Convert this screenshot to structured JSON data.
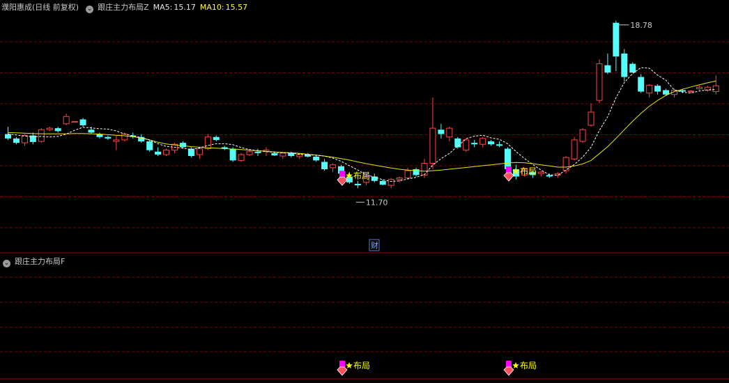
{
  "header": {
    "stock_name": "濮阳惠成",
    "period": "(日线 前复权)",
    "indicator_main": "跟庄主力布局Z",
    "ma5_label": "MA5:",
    "ma5_value": "15.17",
    "ma10_label": "MA10:",
    "ma10_value": "15.57"
  },
  "sub_panel": {
    "indicator": "跟庄主力布局F"
  },
  "colors": {
    "background": "#000000",
    "grid": "#7a0000",
    "separator": "#a00000",
    "up": "#ff4444",
    "down": "#54fcfc",
    "ma5": "#ffffff",
    "ma10": "#e8e800",
    "header_text": "#c8c8c8",
    "ma5_text": "#e6e6e6",
    "ma10_text": "#ffff33",
    "signal_star": "#ffff00",
    "signal_block": "#ff00ff",
    "signal_gem": "#ff5060"
  },
  "chart_data": {
    "type": "candlestick",
    "ylim": [
      11.4,
      19.2
    ],
    "candles": [
      [
        15.05,
        15.3,
        14.85,
        14.9
      ],
      [
        14.9,
        14.95,
        14.7,
        14.75
      ],
      [
        14.75,
        15.05,
        14.65,
        15.0
      ],
      [
        15.0,
        15.1,
        14.7,
        14.78
      ],
      [
        14.8,
        15.25,
        14.75,
        15.2
      ],
      [
        15.2,
        15.3,
        15.15,
        15.25
      ],
      [
        15.25,
        15.3,
        15.1,
        15.15
      ],
      [
        15.4,
        15.75,
        15.35,
        15.65
      ],
      [
        15.45,
        15.5,
        15.45,
        15.48
      ],
      [
        15.55,
        15.6,
        15.3,
        15.35
      ],
      [
        15.2,
        15.3,
        15.05,
        15.1
      ],
      [
        15.05,
        15.1,
        14.9,
        14.95
      ],
      [
        14.95,
        15.0,
        14.85,
        14.9
      ],
      [
        14.8,
        15.0,
        14.5,
        14.85
      ],
      [
        14.85,
        15.1,
        14.8,
        15.05
      ],
      [
        15.0,
        15.1,
        14.9,
        14.95
      ],
      [
        14.95,
        15.05,
        14.75,
        14.8
      ],
      [
        14.8,
        14.85,
        14.45,
        14.5
      ],
      [
        14.45,
        14.6,
        14.3,
        14.35
      ],
      [
        14.35,
        14.55,
        14.3,
        14.5
      ],
      [
        14.5,
        14.75,
        14.4,
        14.7
      ],
      [
        14.75,
        14.8,
        14.55,
        14.6
      ],
      [
        14.55,
        14.6,
        14.25,
        14.3
      ],
      [
        14.35,
        14.6,
        14.2,
        14.55
      ],
      [
        14.55,
        15.05,
        14.5,
        14.95
      ],
      [
        14.95,
        15.0,
        14.8,
        14.85
      ],
      [
        14.6,
        14.65,
        14.5,
        14.55
      ],
      [
        14.55,
        14.6,
        14.1,
        14.15
      ],
      [
        14.15,
        14.4,
        14.1,
        14.35
      ],
      [
        14.35,
        14.5,
        14.3,
        14.45
      ],
      [
        14.45,
        14.55,
        14.3,
        14.4
      ],
      [
        14.45,
        14.6,
        14.3,
        14.5
      ],
      [
        14.4,
        14.45,
        14.3,
        14.32
      ],
      [
        14.3,
        14.45,
        14.2,
        14.4
      ],
      [
        14.4,
        14.45,
        14.25,
        14.3
      ],
      [
        14.28,
        14.4,
        14.2,
        14.35
      ],
      [
        14.35,
        14.4,
        14.25,
        14.28
      ],
      [
        14.28,
        14.32,
        14.1,
        14.15
      ],
      [
        14.1,
        14.2,
        13.8,
        13.85
      ],
      [
        13.9,
        14.05,
        13.75,
        14.0
      ],
      [
        13.95,
        14.0,
        13.65,
        13.7
      ],
      [
        13.6,
        13.75,
        13.35,
        13.4
      ],
      [
        13.35,
        13.45,
        13.2,
        13.3
      ],
      [
        13.4,
        13.7,
        13.3,
        13.6
      ],
      [
        13.6,
        13.7,
        13.4,
        13.45
      ],
      [
        13.45,
        13.5,
        13.3,
        13.32
      ],
      [
        13.3,
        13.55,
        13.2,
        13.5
      ],
      [
        13.5,
        13.6,
        13.4,
        13.55
      ],
      [
        13.55,
        13.9,
        13.5,
        13.8
      ],
      [
        13.85,
        13.9,
        13.6,
        13.65
      ],
      [
        13.65,
        14.2,
        13.55,
        14.05
      ],
      [
        14.05,
        16.3,
        13.85,
        15.25
      ],
      [
        15.2,
        15.4,
        14.9,
        15.05
      ],
      [
        14.95,
        15.3,
        14.8,
        15.25
      ],
      [
        14.9,
        14.95,
        14.55,
        14.6
      ],
      [
        14.5,
        14.9,
        14.45,
        14.85
      ],
      [
        14.75,
        14.85,
        14.6,
        14.7
      ],
      [
        14.7,
        14.95,
        14.6,
        14.9
      ],
      [
        14.8,
        14.85,
        14.65,
        14.7
      ],
      [
        14.7,
        14.8,
        14.6,
        14.65
      ],
      [
        14.55,
        14.6,
        13.8,
        13.85
      ],
      [
        13.85,
        14.0,
        13.5,
        13.6
      ],
      [
        13.65,
        13.9,
        13.6,
        13.85
      ],
      [
        13.75,
        13.8,
        13.55,
        13.65
      ],
      [
        13.7,
        13.8,
        13.6,
        13.75
      ],
      [
        13.65,
        13.7,
        13.55,
        13.6
      ],
      [
        13.65,
        13.75,
        13.55,
        13.7
      ],
      [
        13.8,
        14.3,
        13.7,
        14.25
      ],
      [
        14.2,
        14.95,
        14.15,
        14.85
      ],
      [
        14.8,
        15.25,
        14.75,
        15.2
      ],
      [
        15.35,
        16.1,
        15.3,
        15.8
      ],
      [
        16.2,
        17.6,
        16.1,
        17.45
      ],
      [
        17.4,
        17.8,
        17.1,
        17.15
      ],
      [
        18.85,
        18.92,
        17.2,
        17.7
      ],
      [
        17.8,
        17.95,
        16.85,
        17.0
      ],
      [
        17.45,
        17.5,
        17.15,
        17.15
      ],
      [
        17.0,
        17.1,
        16.45,
        16.5
      ],
      [
        16.45,
        16.75,
        16.3,
        16.72
      ],
      [
        16.7,
        16.75,
        16.4,
        16.5
      ],
      [
        16.55,
        16.6,
        16.35,
        16.4
      ],
      [
        16.4,
        16.6,
        16.3,
        16.55
      ],
      [
        16.55,
        16.6,
        16.45,
        16.5
      ],
      [
        16.5,
        16.55,
        16.45,
        16.52
      ],
      [
        16.6,
        16.7,
        16.55,
        16.65
      ],
      [
        16.55,
        16.7,
        16.5,
        16.65
      ],
      [
        16.5,
        17.05,
        16.4,
        16.7
      ]
    ],
    "ma5": [
      15.05,
      15.02,
      14.98,
      14.96,
      14.97,
      14.95,
      14.97,
      15.05,
      15.18,
      15.28,
      15.26,
      15.23,
      15.22,
      15.16,
      15.05,
      14.99,
      14.93,
      14.85,
      14.72,
      14.63,
      14.6,
      14.57,
      14.52,
      14.58,
      14.66,
      14.72,
      14.72,
      14.69,
      14.59,
      14.52,
      14.48,
      14.45,
      14.43,
      14.41,
      14.4,
      14.36,
      14.34,
      14.33,
      14.3,
      14.23,
      14.12,
      13.97,
      13.82,
      13.66,
      13.58,
      13.49,
      13.43,
      13.45,
      13.52,
      13.57,
      13.67,
      13.99,
      14.21,
      14.39,
      14.64,
      14.89,
      14.98,
      15.01,
      14.92,
      14.87,
      14.72,
      14.45,
      14.22,
      14.01,
      13.82,
      13.66,
      13.64,
      13.82,
      14.01,
      14.26,
      14.6,
      15.17,
      15.64,
      16.29,
      16.81,
      17.12,
      17.32,
      17.3,
      17.06,
      16.89,
      16.55,
      16.48,
      16.45,
      16.52,
      16.56,
      16.57
    ],
    "ma10": [
      15.1,
      15.09,
      15.08,
      15.07,
      15.06,
      15.06,
      15.06,
      15.06,
      15.07,
      15.07,
      15.06,
      15.05,
      15.03,
      15.01,
      14.99,
      14.96,
      14.91,
      14.85,
      14.77,
      14.71,
      14.68,
      14.65,
      14.62,
      14.6,
      14.58,
      14.57,
      14.55,
      14.54,
      14.52,
      14.5,
      14.48,
      14.46,
      14.44,
      14.42,
      14.41,
      14.39,
      14.36,
      14.33,
      14.3,
      14.26,
      14.21,
      14.16,
      14.1,
      14.04,
      13.99,
      13.94,
      13.89,
      13.85,
      13.82,
      13.8,
      13.78,
      13.8,
      13.82,
      13.85,
      13.88,
      13.91,
      13.94,
      13.97,
      14.0,
      14.03,
      14.06,
      14.08,
      14.07,
      14.04,
      14.0,
      13.96,
      13.92,
      13.92,
      13.96,
      14.03,
      14.15,
      14.38,
      14.62,
      14.9,
      15.2,
      15.49,
      15.76,
      16.0,
      16.2,
      16.37,
      16.5,
      16.58,
      16.66,
      16.73,
      16.8,
      16.86
    ],
    "annotations": {
      "high_label": "18.78",
      "low_label": "11.70",
      "finance_marker": "财",
      "signal_text": "布局"
    },
    "signals_at": [
      40,
      60
    ]
  }
}
